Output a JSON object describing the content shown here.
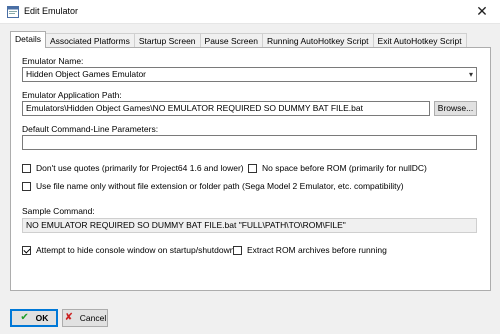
{
  "window": {
    "title": "Edit Emulator",
    "close_glyph": "✕"
  },
  "tabs": [
    {
      "label": "Details",
      "active": true
    },
    {
      "label": "Associated Platforms",
      "active": false
    },
    {
      "label": "Startup Screen",
      "active": false
    },
    {
      "label": "Pause Screen",
      "active": false
    },
    {
      "label": "Running AutoHotkey Script",
      "active": false
    },
    {
      "label": "Exit AutoHotkey Script",
      "active": false
    }
  ],
  "details": {
    "name_label": "Emulator Name:",
    "name_value": "Hidden Object Games Emulator",
    "path_label": "Emulator Application Path:",
    "path_value": "Emulators\\Hidden Object Games\\NO EMULATOR REQUIRED SO DUMMY BAT FILE.bat",
    "browse_label": "Browse...",
    "params_label": "Default Command-Line Parameters:",
    "params_value": "",
    "options": {
      "dont_use_quotes": {
        "label": "Don't use quotes (primarily for Project64 1.6 and lower)",
        "checked": false
      },
      "no_space_before_rom": {
        "label": "No space before ROM (primarily for nullDC)",
        "checked": false
      },
      "file_name_only": {
        "label": "Use file name only without file extension or folder path (Sega Model 2 Emulator, etc. compatibility)",
        "checked": false
      }
    },
    "sample_label": "Sample Command:",
    "sample_value": "NO EMULATOR REQUIRED SO DUMMY BAT FILE.bat \"FULL\\PATH\\TO\\ROM\\FILE\"",
    "hide_console": {
      "label": "Attempt to hide console window on startup/shutdown",
      "checked": true
    },
    "extract_rom": {
      "label": "Extract ROM archives before running",
      "checked": false
    }
  },
  "footer": {
    "ok_label": "OK",
    "cancel_label": "Cancel"
  },
  "icons": {
    "app": "app-window-icon",
    "ok": "checkmark-icon",
    "cancel": "x-icon"
  },
  "colors": {
    "accent": "#0078d7",
    "ok_icon": "#1f9e2a",
    "cancel_icon": "#cc2222"
  }
}
